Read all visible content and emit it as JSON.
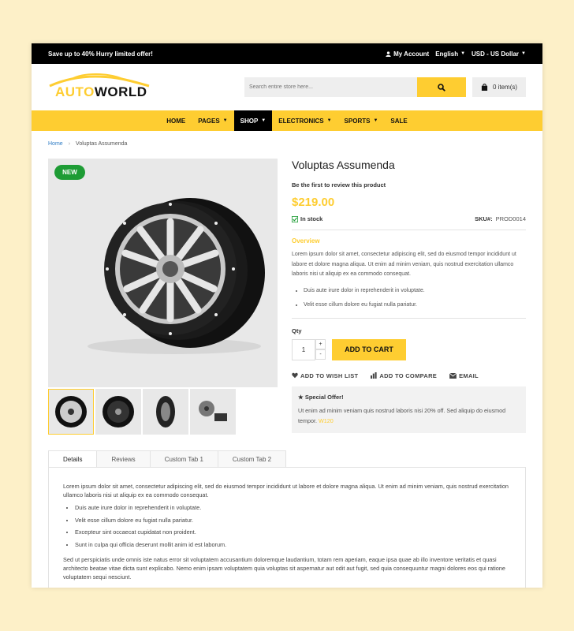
{
  "topbar": {
    "promo": "Save up to 40% Hurry limited offer!",
    "account": "My Account",
    "language": "English",
    "currency": "USD - US Dollar"
  },
  "logo": {
    "part1": "AUTO",
    "part2": "WORLD"
  },
  "search": {
    "placeholder": "Search entire store here..."
  },
  "cart": {
    "label": "0 item(s)"
  },
  "nav": [
    {
      "label": "HOME"
    },
    {
      "label": "PAGES"
    },
    {
      "label": "SHOP"
    },
    {
      "label": "ELECTRONICS"
    },
    {
      "label": "SPORTS"
    },
    {
      "label": "SALE"
    }
  ],
  "breadcrumb": {
    "home": "Home",
    "current": "Voluptas Assumenda"
  },
  "product": {
    "badge": "NEW",
    "title": "Voluptas Assumenda",
    "review": "Be the first to review this product",
    "price": "$219.00",
    "stock": "In stock",
    "sku_label": "SKU#:",
    "sku": "PROD0014",
    "overview_title": "Overview",
    "overview_text": "Lorem ipsum dolor sit amet, consectetur adipiscing elit, sed do eiusmod tempor incididunt ut labore et dolore magna aliqua. Ut enim ad minim veniam, quis nostrud exercitation ullamco laboris nisi ut aliquip ex ea commodo consequat.",
    "bullets": [
      "Duis aute irure dolor in reprehenderit in voluptate.",
      "Velit esse cillum dolore eu fugiat nulla pariatur."
    ],
    "qty_label": "Qty",
    "qty": "1",
    "add_to_cart": "ADD TO CART",
    "wishlist": "ADD TO WISH LIST",
    "compare": "ADD TO COMPARE",
    "email": "EMAIL",
    "offer_title": "Special Offer!",
    "offer_text": "Ut enim ad minim veniam quis nostrud laboris nisi 20% off. Sed aliquip do eiusmod tempor.",
    "offer_code": "W120"
  },
  "tabs": [
    {
      "label": "Details"
    },
    {
      "label": "Reviews"
    },
    {
      "label": "Custom Tab 1"
    },
    {
      "label": "Custom Tab 2"
    }
  ],
  "details": {
    "intro": "Lorem ipsum dolor sit amet, consectetur adipiscing elit, sed do eiusmod tempor incididunt ut labore et dolore magna aliqua. Ut enim ad minim veniam, quis nostrud exercitation ullamco laboris nisi ut aliquip ex ea commodo consequat.",
    "bullets": [
      "Duis aute irure dolor in reprehenderit in voluptate.",
      "Velit esse cillum dolore eu fugiat nulla pariatur.",
      "Excepteur sint occaecat cupidatat non proident.",
      "Sunt in culpa qui officia deserunt mollit anim id est laborum."
    ],
    "outro": "Sed ut perspiciatis unde omnis iste natus error sit voluptatem accusantium doloremque laudantium, totam rem aperiam, eaque ipsa quae ab illo inventore veritatis et quasi architecto beatae vitae dicta sunt explicabo. Nemo enim ipsam voluptatem quia voluptas sit aspernatur aut odit aut fugit, sed quia consequuntur magni dolores eos qui ratione voluptatem sequi nesciunt."
  },
  "colors": {
    "accent": "#fecd31",
    "stock": "#1e9c35",
    "link": "#2d7bc4"
  }
}
